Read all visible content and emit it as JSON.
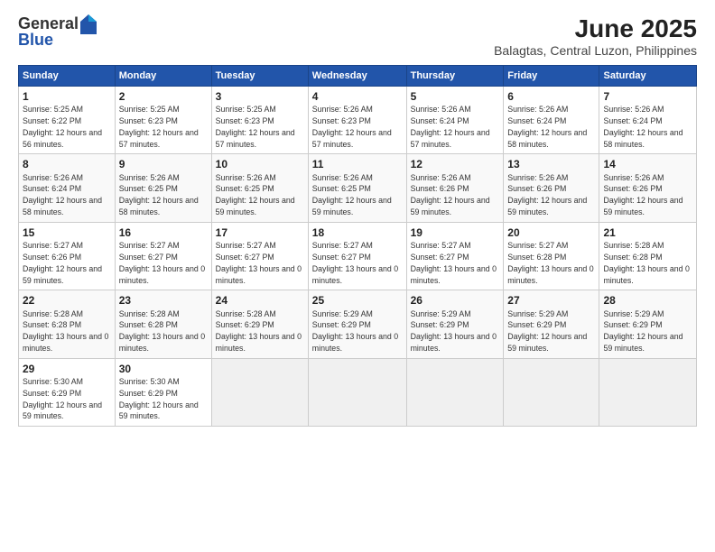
{
  "logo": {
    "general": "General",
    "blue": "Blue"
  },
  "title": "June 2025",
  "subtitle": "Balagtas, Central Luzon, Philippines",
  "days": [
    "Sunday",
    "Monday",
    "Tuesday",
    "Wednesday",
    "Thursday",
    "Friday",
    "Saturday"
  ],
  "weeks": [
    [
      {
        "day": 1,
        "sunrise": "5:25 AM",
        "sunset": "6:22 PM",
        "daylight": "12 hours and 56 minutes."
      },
      {
        "day": 2,
        "sunrise": "5:25 AM",
        "sunset": "6:23 PM",
        "daylight": "12 hours and 57 minutes."
      },
      {
        "day": 3,
        "sunrise": "5:25 AM",
        "sunset": "6:23 PM",
        "daylight": "12 hours and 57 minutes."
      },
      {
        "day": 4,
        "sunrise": "5:26 AM",
        "sunset": "6:23 PM",
        "daylight": "12 hours and 57 minutes."
      },
      {
        "day": 5,
        "sunrise": "5:26 AM",
        "sunset": "6:24 PM",
        "daylight": "12 hours and 57 minutes."
      },
      {
        "day": 6,
        "sunrise": "5:26 AM",
        "sunset": "6:24 PM",
        "daylight": "12 hours and 58 minutes."
      },
      {
        "day": 7,
        "sunrise": "5:26 AM",
        "sunset": "6:24 PM",
        "daylight": "12 hours and 58 minutes."
      }
    ],
    [
      {
        "day": 8,
        "sunrise": "5:26 AM",
        "sunset": "6:24 PM",
        "daylight": "12 hours and 58 minutes."
      },
      {
        "day": 9,
        "sunrise": "5:26 AM",
        "sunset": "6:25 PM",
        "daylight": "12 hours and 58 minutes."
      },
      {
        "day": 10,
        "sunrise": "5:26 AM",
        "sunset": "6:25 PM",
        "daylight": "12 hours and 59 minutes."
      },
      {
        "day": 11,
        "sunrise": "5:26 AM",
        "sunset": "6:25 PM",
        "daylight": "12 hours and 59 minutes."
      },
      {
        "day": 12,
        "sunrise": "5:26 AM",
        "sunset": "6:26 PM",
        "daylight": "12 hours and 59 minutes."
      },
      {
        "day": 13,
        "sunrise": "5:26 AM",
        "sunset": "6:26 PM",
        "daylight": "12 hours and 59 minutes."
      },
      {
        "day": 14,
        "sunrise": "5:26 AM",
        "sunset": "6:26 PM",
        "daylight": "12 hours and 59 minutes."
      }
    ],
    [
      {
        "day": 15,
        "sunrise": "5:27 AM",
        "sunset": "6:26 PM",
        "daylight": "12 hours and 59 minutes."
      },
      {
        "day": 16,
        "sunrise": "5:27 AM",
        "sunset": "6:27 PM",
        "daylight": "13 hours and 0 minutes."
      },
      {
        "day": 17,
        "sunrise": "5:27 AM",
        "sunset": "6:27 PM",
        "daylight": "13 hours and 0 minutes."
      },
      {
        "day": 18,
        "sunrise": "5:27 AM",
        "sunset": "6:27 PM",
        "daylight": "13 hours and 0 minutes."
      },
      {
        "day": 19,
        "sunrise": "5:27 AM",
        "sunset": "6:27 PM",
        "daylight": "13 hours and 0 minutes."
      },
      {
        "day": 20,
        "sunrise": "5:27 AM",
        "sunset": "6:28 PM",
        "daylight": "13 hours and 0 minutes."
      },
      {
        "day": 21,
        "sunrise": "5:28 AM",
        "sunset": "6:28 PM",
        "daylight": "13 hours and 0 minutes."
      }
    ],
    [
      {
        "day": 22,
        "sunrise": "5:28 AM",
        "sunset": "6:28 PM",
        "daylight": "13 hours and 0 minutes."
      },
      {
        "day": 23,
        "sunrise": "5:28 AM",
        "sunset": "6:28 PM",
        "daylight": "13 hours and 0 minutes."
      },
      {
        "day": 24,
        "sunrise": "5:28 AM",
        "sunset": "6:29 PM",
        "daylight": "13 hours and 0 minutes."
      },
      {
        "day": 25,
        "sunrise": "5:29 AM",
        "sunset": "6:29 PM",
        "daylight": "13 hours and 0 minutes."
      },
      {
        "day": 26,
        "sunrise": "5:29 AM",
        "sunset": "6:29 PM",
        "daylight": "13 hours and 0 minutes."
      },
      {
        "day": 27,
        "sunrise": "5:29 AM",
        "sunset": "6:29 PM",
        "daylight": "12 hours and 59 minutes."
      },
      {
        "day": 28,
        "sunrise": "5:29 AM",
        "sunset": "6:29 PM",
        "daylight": "12 hours and 59 minutes."
      }
    ],
    [
      {
        "day": 29,
        "sunrise": "5:30 AM",
        "sunset": "6:29 PM",
        "daylight": "12 hours and 59 minutes."
      },
      {
        "day": 30,
        "sunrise": "5:30 AM",
        "sunset": "6:29 PM",
        "daylight": "12 hours and 59 minutes."
      },
      null,
      null,
      null,
      null,
      null
    ]
  ]
}
